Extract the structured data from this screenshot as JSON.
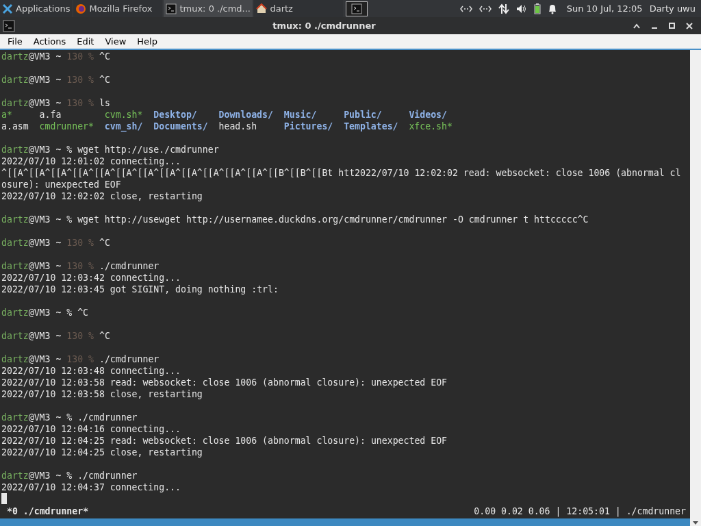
{
  "panel": {
    "apps": [
      {
        "label": "Applications",
        "kind": "menu",
        "selected": false
      },
      {
        "label": "Mozilla Firefox",
        "kind": "firefox",
        "selected": false
      },
      {
        "label": "tmux: 0 ./cmd...",
        "kind": "terminal",
        "selected": true
      },
      {
        "label": "dartz",
        "kind": "home",
        "selected": false
      }
    ],
    "clock": "Sun 10 Jul, 12:05",
    "user": "Darty uwu"
  },
  "window": {
    "title": "tmux: 0 ./cmdrunner"
  },
  "menu": [
    "File",
    "Actions",
    "Edit",
    "View",
    "Help"
  ],
  "lines": [
    {
      "kind": "prompt",
      "user": "dartz",
      "host": "@VM3 ~",
      "status": "130",
      "symbol": "%",
      "command": "^C"
    },
    {
      "kind": "blank"
    },
    {
      "kind": "prompt",
      "user": "dartz",
      "host": "@VM3 ~",
      "status": "130",
      "symbol": "%",
      "command": "^C"
    },
    {
      "kind": "blank"
    },
    {
      "kind": "prompt",
      "user": "dartz",
      "host": "@VM3 ~",
      "status": "130",
      "symbol": "%",
      "command": "ls"
    },
    {
      "kind": "ls",
      "entries": [
        {
          "text": "a*",
          "kind": "exec"
        },
        {
          "text": "a.fa",
          "kind": "file"
        },
        {
          "text": "cvm.sh*",
          "kind": "exec"
        },
        {
          "text": "Desktop/",
          "kind": "dir"
        },
        {
          "text": "Downloads/",
          "kind": "dir"
        },
        {
          "text": "Music/",
          "kind": "dir"
        },
        {
          "text": "Public/",
          "kind": "dir"
        },
        {
          "text": "Videos/",
          "kind": "dir"
        }
      ]
    },
    {
      "kind": "ls",
      "entries": [
        {
          "text": "a.asm",
          "kind": "file"
        },
        {
          "text": "cmdrunner*",
          "kind": "exec"
        },
        {
          "text": "cvm_sh/",
          "kind": "dir"
        },
        {
          "text": "Documents/",
          "kind": "dir"
        },
        {
          "text": "head.sh",
          "kind": "file"
        },
        {
          "text": "Pictures/",
          "kind": "dir"
        },
        {
          "text": "Templates/",
          "kind": "dir"
        },
        {
          "text": "xfce.sh*",
          "kind": "exec"
        }
      ]
    },
    {
      "kind": "blank"
    },
    {
      "kind": "prompt",
      "user": "dartz",
      "host": "@VM3 ~",
      "symbol": "%",
      "command": "wget http://use./cmdrunner"
    },
    {
      "kind": "output",
      "text": "2022/07/10 12:01:02 connecting..."
    },
    {
      "kind": "output",
      "text": "^[[A^[[A^[[A^[[A^[[A^[[A^[[A^[[A^[[A^[[A^[[A^[[A^[[B^[[B^[[Bt htt2022/07/10 12:02:02 read: websocket: close 1006 (abnormal cl"
    },
    {
      "kind": "output",
      "text": "osure): unexpected EOF"
    },
    {
      "kind": "output",
      "text": "2022/07/10 12:02:02 close, restarting"
    },
    {
      "kind": "blank"
    },
    {
      "kind": "prompt",
      "user": "dartz",
      "host": "@VM3 ~",
      "symbol": "%",
      "command": "wget http://usewget http://usernamee.duckdns.org/cmdrunner/cmdrunner -O cmdrunner t httccccc^C"
    },
    {
      "kind": "blank"
    },
    {
      "kind": "prompt",
      "user": "dartz",
      "host": "@VM3 ~",
      "status": "130",
      "symbol": "%",
      "command": "^C"
    },
    {
      "kind": "blank"
    },
    {
      "kind": "prompt",
      "user": "dartz",
      "host": "@VM3 ~",
      "status": "130",
      "symbol": "%",
      "command": "./cmdrunner"
    },
    {
      "kind": "output",
      "text": "2022/07/10 12:03:42 connecting..."
    },
    {
      "kind": "output",
      "text": "2022/07/10 12:03:45 got SIGINT, doing nothing :trl:"
    },
    {
      "kind": "blank"
    },
    {
      "kind": "prompt",
      "user": "dartz",
      "host": "@VM3 ~",
      "symbol": "%",
      "command": "^C"
    },
    {
      "kind": "blank"
    },
    {
      "kind": "prompt",
      "user": "dartz",
      "host": "@VM3 ~",
      "status": "130",
      "symbol": "%",
      "command": "^C"
    },
    {
      "kind": "blank"
    },
    {
      "kind": "prompt",
      "user": "dartz",
      "host": "@VM3 ~",
      "status": "130",
      "symbol": "%",
      "command": "./cmdrunner"
    },
    {
      "kind": "output",
      "text": "2022/07/10 12:03:48 connecting..."
    },
    {
      "kind": "output",
      "text": "2022/07/10 12:03:58 read: websocket: close 1006 (abnormal closure): unexpected EOF"
    },
    {
      "kind": "output",
      "text": "2022/07/10 12:03:58 close, restarting"
    },
    {
      "kind": "blank"
    },
    {
      "kind": "prompt",
      "user": "dartz",
      "host": "@VM3 ~",
      "symbol": "%",
      "command": "./cmdrunner"
    },
    {
      "kind": "output",
      "text": "2022/07/10 12:04:16 connecting..."
    },
    {
      "kind": "output",
      "text": "2022/07/10 12:04:25 read: websocket: close 1006 (abnormal closure): unexpected EOF"
    },
    {
      "kind": "output",
      "text": "2022/07/10 12:04:25 close, restarting"
    },
    {
      "kind": "blank"
    },
    {
      "kind": "prompt",
      "user": "dartz",
      "host": "@VM3 ~",
      "symbol": "%",
      "command": "./cmdrunner"
    },
    {
      "kind": "output",
      "text": "2022/07/10 12:04:37 connecting..."
    },
    {
      "kind": "cursor"
    }
  ],
  "status_bar": {
    "left": "*0 ./cmdrunner*",
    "right": "0.00 0.02 0.06 | 12:05:01 | ./cmdrunner"
  }
}
